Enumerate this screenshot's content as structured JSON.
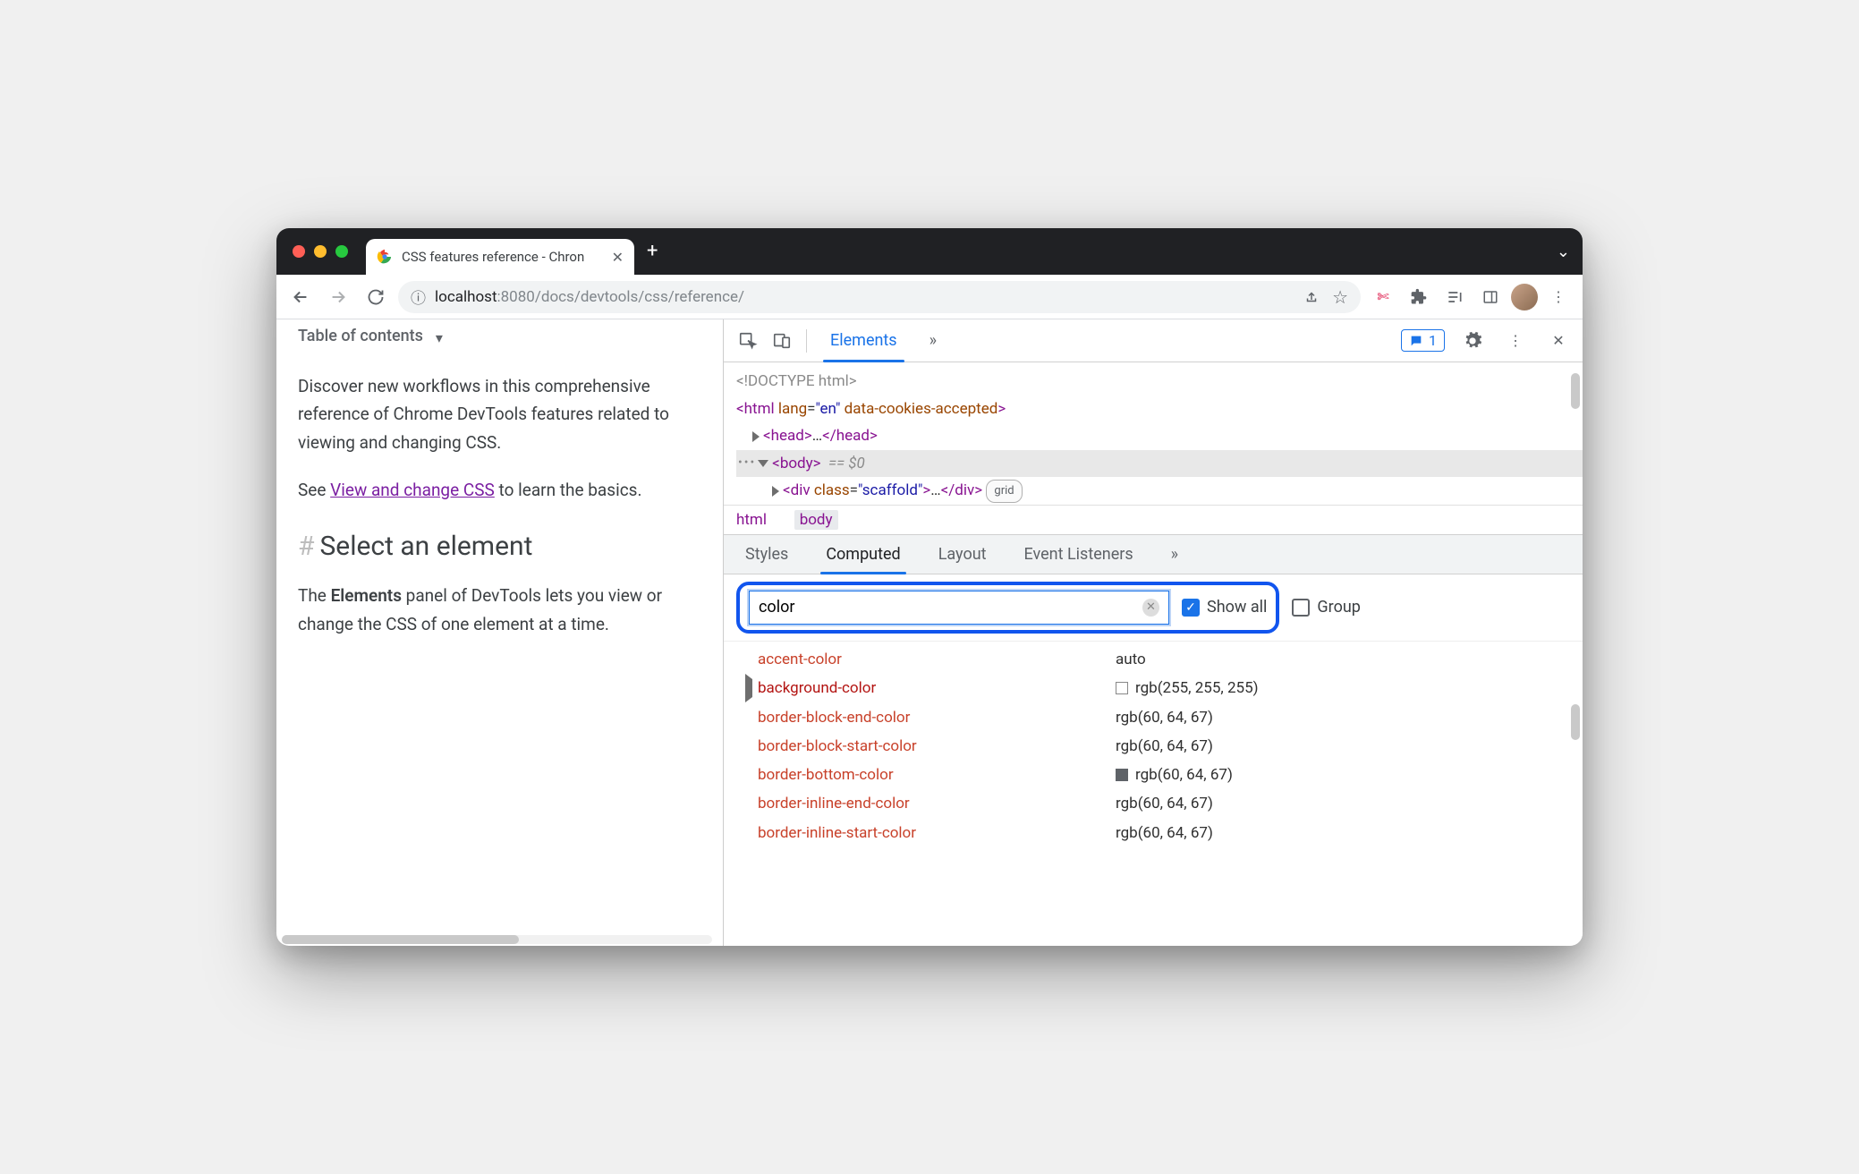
{
  "tab": {
    "title": "CSS features reference - Chron"
  },
  "address": {
    "scheme_icon": "ⓘ",
    "host": "localhost",
    "port": ":8080",
    "path": "/docs/devtools/css/reference/"
  },
  "page": {
    "toc_label": "Table of contents",
    "intro": "Discover new workflows in this comprehensive reference of Chrome DevTools features related to viewing and changing CSS.",
    "see_prefix": "See ",
    "see_link": "View and change CSS",
    "see_suffix": " to learn the basics.",
    "heading": "Select an element",
    "body_p": "The Elements panel of DevTools lets you view or change the CSS of one element at a time.",
    "bold_word": "Elements"
  },
  "devtools": {
    "main_tab": "Elements",
    "issues_count": "1",
    "dom": {
      "doctype": "<!DOCTYPE html>",
      "html_open": "<html lang=\"en\" data-cookies-accepted>",
      "head": "<head>…</head>",
      "body_open": "<body>",
      "dollar": "== $0",
      "div": "<div class=\"scaffold\">…</div>",
      "grid_badge": "grid"
    },
    "crumbs": {
      "a": "html",
      "b": "body"
    },
    "subtabs": [
      "Styles",
      "Computed",
      "Layout",
      "Event Listeners"
    ],
    "subtabs_active": 1,
    "filter": {
      "value": "color",
      "showall_label": "Show all",
      "group_label": "Group"
    },
    "props": [
      {
        "name": "accent-color",
        "value": "auto",
        "expand": false,
        "swatch": null
      },
      {
        "name": "background-color",
        "value": "rgb(255, 255, 255)",
        "expand": true,
        "swatch": "white",
        "strong": true
      },
      {
        "name": "border-block-end-color",
        "value": "rgb(60, 64, 67)",
        "expand": false,
        "swatch": null
      },
      {
        "name": "border-block-start-color",
        "value": "rgb(60, 64, 67)",
        "expand": false,
        "swatch": null
      },
      {
        "name": "border-bottom-color",
        "value": "rgb(60, 64, 67)",
        "expand": false,
        "swatch": "gray"
      },
      {
        "name": "border-inline-end-color",
        "value": "rgb(60, 64, 67)",
        "expand": false,
        "swatch": null
      },
      {
        "name": "border-inline-start-color",
        "value": "rgb(60, 64, 67)",
        "expand": false,
        "swatch": null
      }
    ]
  }
}
